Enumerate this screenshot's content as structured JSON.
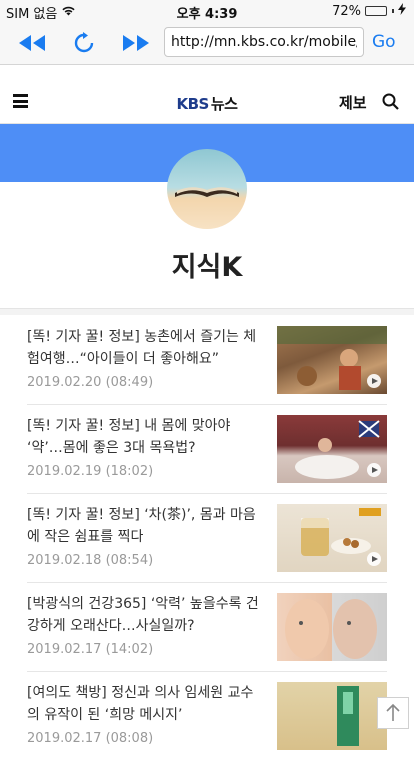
{
  "status_bar": {
    "carrier": "SIM 없음",
    "time": "오후 4:39",
    "battery": "72%",
    "battery_level": 0.72
  },
  "browser": {
    "url": "http://mn.kbs.co.kr/mobile/...",
    "go_label": "Go"
  },
  "header": {
    "logo_brand": "KBS",
    "logo_suffix": "뉴스",
    "report_label": "제보"
  },
  "section": {
    "title": "지식K"
  },
  "articles": [
    {
      "title": "[똑! 기자 꿀! 정보] 농촌에서 즐기는 체험여행…“아이들이 더 좋아해요”",
      "date": "2019.02.20 (08:49)"
    },
    {
      "title": "[똑! 기자 꿀! 정보] 내 몸에 맞아야 ‘약’…몸에 좋은 3대 목욕법?",
      "date": "2019.02.19 (18:02)"
    },
    {
      "title": "[똑! 기자 꿀! 정보] ‘차(茶)’, 몸과 마음에 작은 쉼표를 찍다",
      "date": "2019.02.18 (08:54)"
    },
    {
      "title": "[박광식의 건강365] ‘악력’ 높을수록 건강하게 오래산다…사실일까?",
      "date": "2019.02.17 (14:02)"
    },
    {
      "title": "[여의도 책방] 정신과 의사 임세원 교수의 유작이 된 ‘희망 메시지’",
      "date": "2019.02.17 (08:08)"
    }
  ]
}
